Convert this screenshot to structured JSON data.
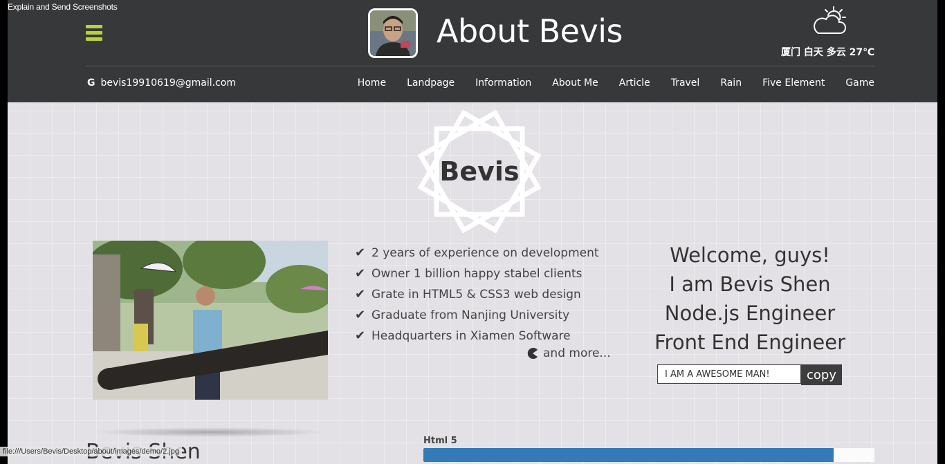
{
  "overlay": {
    "text": "Explain and Send Screenshots"
  },
  "header": {
    "title": "About Bevis",
    "weather": "厦门 白天 多云 27℃",
    "email": "bevis19910619@gmail.com",
    "nav": [
      "Home",
      "Landpage",
      "Information",
      "About Me",
      "Article",
      "Travel",
      "Rain",
      "Five Element",
      "Game"
    ],
    "accent_color": "#b6d33a",
    "bg_color": "#373839"
  },
  "logo": {
    "name": "Bevis"
  },
  "features": [
    "2 years of experience on development",
    "Owner 1 billion happy stabel clients",
    "Grate in HTML5 & CSS3 web design",
    "Graduate from Nanjing University",
    "Headquarters in Xiamen Software"
  ],
  "more": {
    "label": "and more..."
  },
  "welcome": {
    "lines": [
      "Welcome, guys!",
      "I am Bevis Shen",
      "Node.js Engineer",
      "Front End Engineer"
    ]
  },
  "copy": {
    "input_value": "I AM A AWESOME MAN!",
    "button_label": "copy"
  },
  "skills": [
    {
      "label": "Html 5",
      "percent": 91
    }
  ],
  "bottom": {
    "name": "Bevis Shen"
  },
  "status_bar": {
    "url": "file:///Users/Bevis/Desktop/about/images/demo/2.jpg"
  }
}
